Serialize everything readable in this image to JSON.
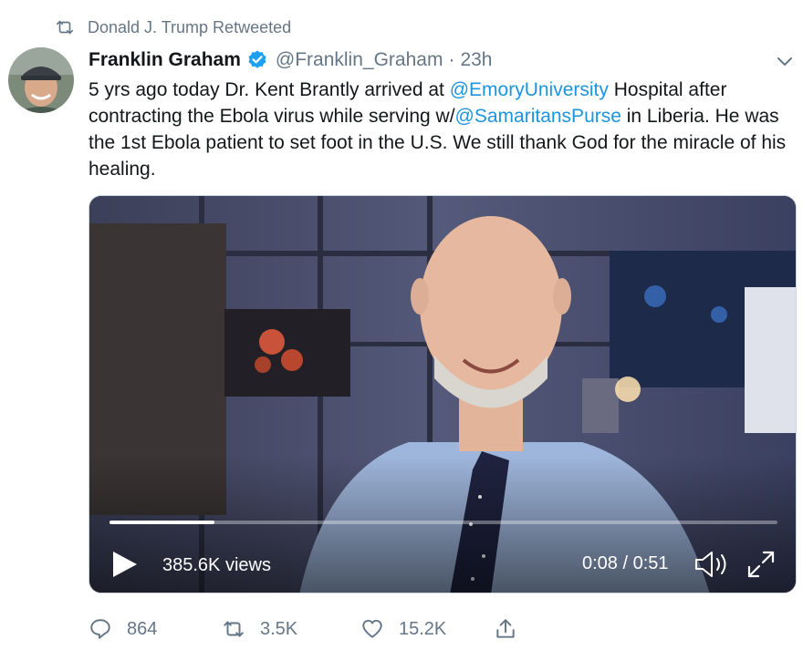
{
  "retweet": {
    "icon": "retweet-icon",
    "text": "Donald J. Trump Retweeted"
  },
  "author": {
    "name": "Franklin Graham",
    "handle": "@Franklin_Graham",
    "separator": "·",
    "time": "23h",
    "verified_icon": "verified-badge-icon"
  },
  "tweet": {
    "segments": [
      {
        "text": "5 yrs ago today Dr. Kent Brantly arrived at ",
        "mention": false
      },
      {
        "text": "@EmoryUniversity",
        "mention": true
      },
      {
        "text": " Hospital after contracting the Ebola virus while serving w/",
        "mention": false
      },
      {
        "text": "@SamaritansPurse",
        "mention": true
      },
      {
        "text": " in Liberia. He was the 1st Ebola patient to set foot in the U.S. We still thank God for the miracle of his healing.",
        "mention": false
      }
    ]
  },
  "video": {
    "views": "385.6K views",
    "timecode": "0:08 / 0:51",
    "progress_fraction": 0.157,
    "controls": {
      "play": "play-icon",
      "volume": "volume-icon",
      "fullscreen": "expand-icon"
    }
  },
  "actions": {
    "reply": {
      "icon": "reply-icon",
      "count": "864"
    },
    "retweet": {
      "icon": "retweet-icon",
      "count": "3.5K"
    },
    "like": {
      "icon": "heart-icon",
      "count": "15.2K"
    },
    "share": {
      "icon": "share-icon"
    }
  },
  "colors": {
    "accent": "#1b95e0",
    "muted": "#657786",
    "text": "#14171a"
  }
}
